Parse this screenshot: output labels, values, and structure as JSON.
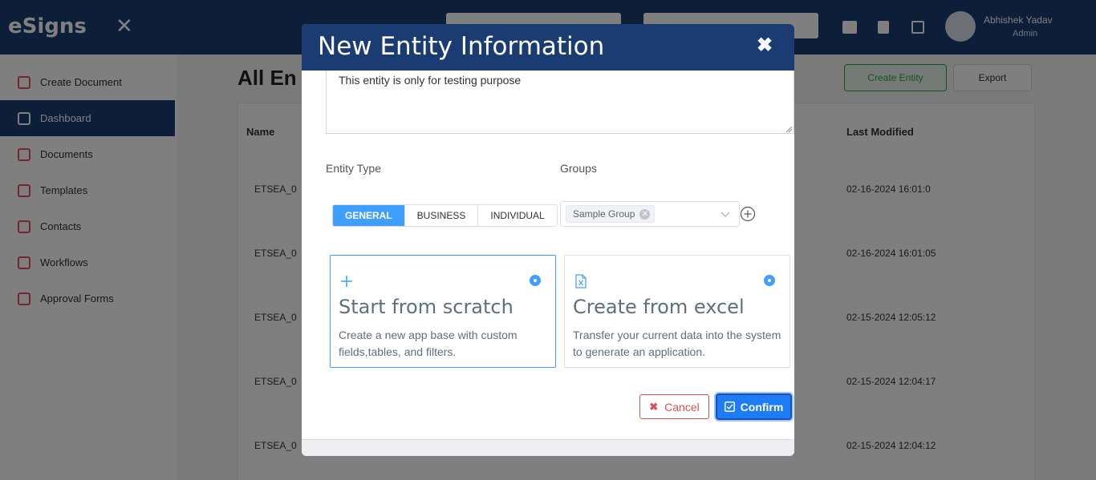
{
  "background": {
    "logo": "eSigns",
    "user_name": "Abhishek Yadav",
    "user_role": "Admin",
    "sidebar": [
      {
        "label": "Create Document"
      },
      {
        "label": "Dashboard"
      },
      {
        "label": "Documents"
      },
      {
        "label": "Templates"
      },
      {
        "label": "Contacts"
      },
      {
        "label": "Workflows"
      },
      {
        "label": "Approval Forms"
      }
    ],
    "page_title": "All En",
    "create_entity_label": "Create Entity",
    "export_label": "Export",
    "table": {
      "columns": [
        "Name",
        "Last Modified"
      ],
      "rows": [
        {
          "name": "ETSEA_0",
          "modified": "02-16-2024 16:01:0"
        },
        {
          "name": "ETSEA_0",
          "modified": "02-16-2024 16:01:05"
        },
        {
          "name": "ETSEA_0",
          "modified": "02-15-2024 12:05:12"
        },
        {
          "name": "ETSEA_0",
          "modified": "02-15-2024 12:04:17"
        },
        {
          "name": "ETSEA_0",
          "modified": "02-15-2024 12:04:12"
        }
      ]
    }
  },
  "modal": {
    "title": "New Entity Information",
    "description_value": "This entity is only for testing purpose",
    "entity_type_label": "Entity Type",
    "groups_label": "Groups",
    "entity_types": [
      {
        "label": "GENERAL",
        "active": true
      },
      {
        "label": "BUSINESS",
        "active": false
      },
      {
        "label": "INDIVIDUAL",
        "active": false
      }
    ],
    "selected_group": "Sample Group",
    "options": [
      {
        "title": "Start from scratch",
        "description": "Create a new app base with custom fields,tables, and filters.",
        "icon": "plus-icon",
        "selected": true
      },
      {
        "title": "Create from excel",
        "description": "Transfer your current data into the system to generate an application.",
        "icon": "excel-file-icon",
        "selected": false
      }
    ],
    "cancel_label": "Cancel",
    "confirm_label": "Confirm"
  },
  "colors": {
    "header_navy": "#1b3c73",
    "primary_blue": "#409eff",
    "confirm_blue": "#1e7cf7",
    "cancel_red": "#d9534f"
  }
}
